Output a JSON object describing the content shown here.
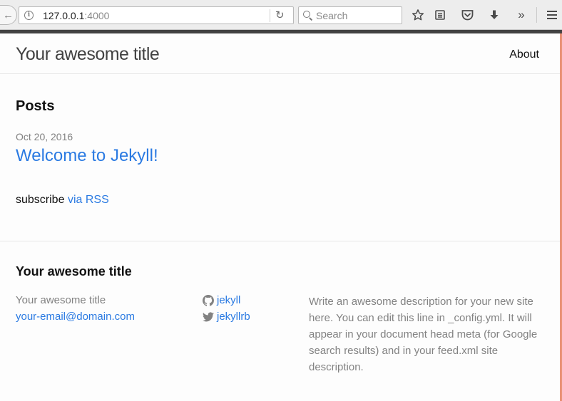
{
  "browser": {
    "url_host": "127.0.0.1",
    "url_port": ":4000",
    "search_placeholder": "Search",
    "toolbar_icons": [
      "back-arrow-icon",
      "info-icon",
      "reload-icon",
      "search-icon",
      "bookmark-star-icon",
      "reading-list-icon",
      "pocket-icon",
      "download-icon",
      "overflow-chevrons-icon",
      "hamburger-menu-icon"
    ]
  },
  "header": {
    "site_title": "Your awesome title",
    "nav": [
      {
        "label": "About"
      }
    ]
  },
  "main": {
    "posts_heading": "Posts",
    "posts": [
      {
        "date": "Oct 20, 2016",
        "title": "Welcome to Jekyll!"
      }
    ],
    "subscribe_prefix": "subscribe",
    "rss_link": "via RSS"
  },
  "footer": {
    "heading": "Your awesome title",
    "name": "Your awesome title",
    "email": "your-email@domain.com",
    "social": {
      "github": "jekyll",
      "twitter": "jekyllrb"
    },
    "description": "Write an awesome description for your new site here. You can edit this line in _config.yml. It will appear in your document head meta (for Google search results) and in your feed.xml site description."
  },
  "colors": {
    "link": "#2a7ae2",
    "text": "#111111",
    "muted": "#828282",
    "top_bar": "#424242",
    "scroll_accent": "#e99276"
  }
}
